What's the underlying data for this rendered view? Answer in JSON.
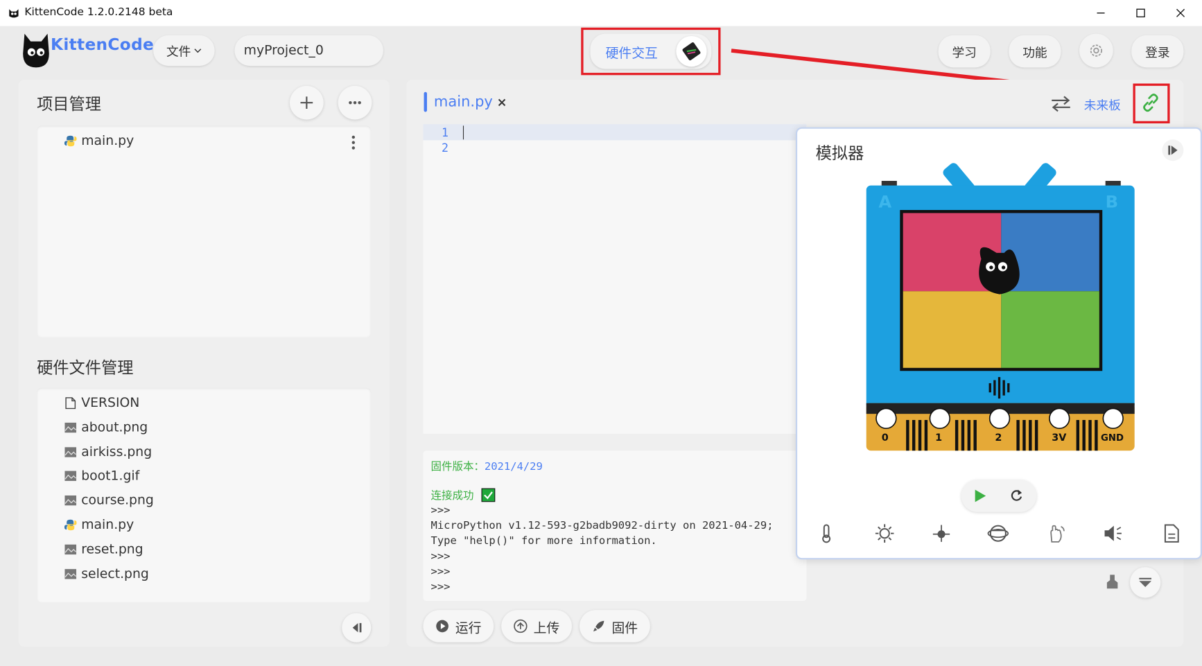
{
  "window": {
    "title": "KittenCode 1.2.0.2148 beta",
    "controls": [
      "minimize",
      "maximize",
      "close"
    ]
  },
  "header": {
    "logo_text": "KittenCode",
    "file_menu": "文件",
    "project_name": "myProject_0",
    "hardware_button": "硬件交互",
    "learn": "学习",
    "features": "功能",
    "login": "登录"
  },
  "project_panel": {
    "title": "项目管理",
    "files": [
      {
        "name": "main.py",
        "icon": "python-icon"
      }
    ]
  },
  "hardware_panel": {
    "title": "硬件文件管理",
    "files": [
      {
        "name": "VERSION",
        "icon": "file-icon"
      },
      {
        "name": "about.png",
        "icon": "image-icon"
      },
      {
        "name": "airkiss.png",
        "icon": "image-icon"
      },
      {
        "name": "boot1.gif",
        "icon": "image-icon"
      },
      {
        "name": "course.png",
        "icon": "image-icon"
      },
      {
        "name": "main.py",
        "icon": "python-icon"
      },
      {
        "name": "reset.png",
        "icon": "image-icon"
      },
      {
        "name": "select.png",
        "icon": "image-icon"
      }
    ]
  },
  "editor": {
    "tab_label": "main.py",
    "tab_close": "×",
    "board_label": "未来板",
    "line_numbers": [
      "1",
      "2"
    ]
  },
  "console": {
    "firmware_label": "固件版本：",
    "firmware_date": "2021/4/29",
    "connected": "连接成功",
    "lines": [
      ">>>",
      "MicroPython v1.12-593-g2badb9092-dirty on 2021-04-29;",
      "Type \"help()\" for more information.",
      ">>>",
      ">>>",
      ">>>"
    ]
  },
  "bottom_buttons": {
    "run": "运行",
    "upload": "上传",
    "firmware": "固件"
  },
  "simulator": {
    "title": "模拟器",
    "board_letters": [
      "A",
      "B"
    ],
    "pins": [
      "0",
      "1",
      "2",
      "3V",
      "GND"
    ],
    "sensors": [
      "thermometer-icon",
      "brightness-icon",
      "joystick-icon",
      "gyroscope-icon",
      "gesture-icon",
      "volume-icon",
      "document-icon"
    ]
  },
  "colors": {
    "accent": "#4b7ef2",
    "highlight": "#e41e26",
    "board": "#1da0e0",
    "green": "#3cb043"
  }
}
